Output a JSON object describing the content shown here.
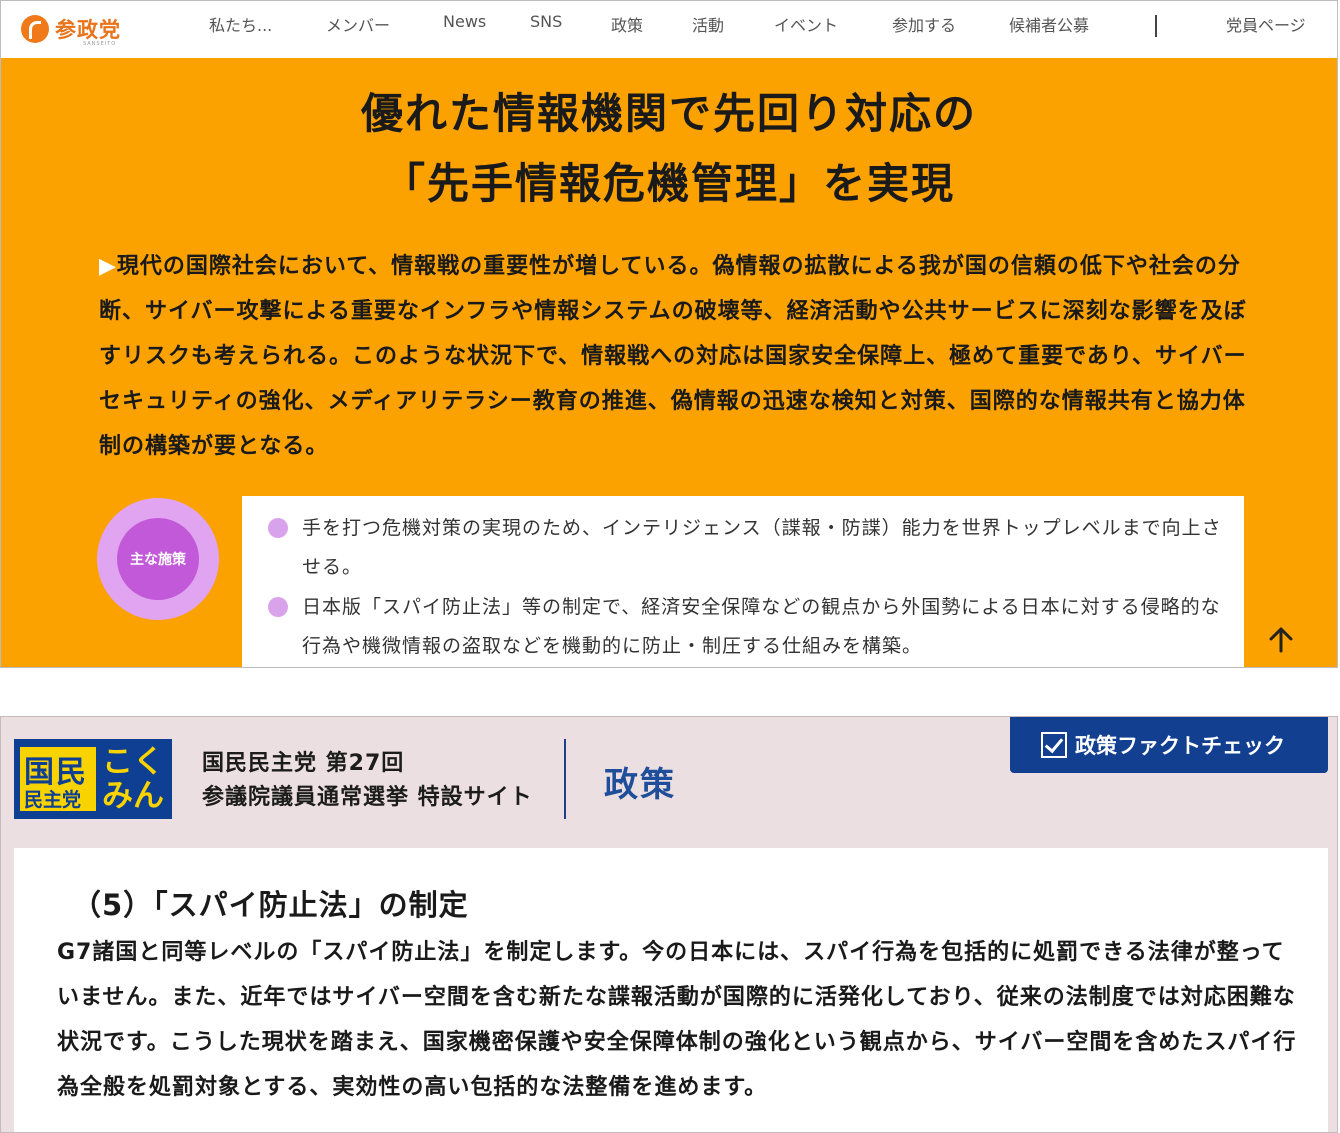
{
  "top": {
    "logo_text": "参政党",
    "logo_sub": "SANSEITO",
    "nav": [
      "私たち...",
      "メンバー",
      "News",
      "SNS",
      "政策",
      "活動",
      "イベント",
      "参加する",
      "候補者公募",
      "党員ページ"
    ],
    "title_line1": "優れた情報機関で先回り対応の",
    "title_line2": "「先手情報危機管理」を実現",
    "intro_marker": "▶",
    "intro": "現代の国際社会において、情報戦の重要性が増している。偽情報の拡散による我が国の信頼の低下や社会の分断、サイバー攻撃による重要なインフラや情報システムの破壊等、経済活動や公共サービスに深刻な影響を及ぼすリスクも考えられる。このような状況下で、情報戦への対応は国家安全保障上、極めて重要であり、サイバーセキュリティの強化、メディアリテラシー教育の推進、偽情報の迅速な検知と対策、国際的な情報共有と協力体制の構築が要となる。",
    "badge": "主な施策",
    "measures": [
      "手を打つ危機対策の実現のため、インテリジェンス（諜報・防諜）能力を世界トップレベルまで向上させる。",
      "日本版「スパイ防止法」等の制定で、経済安全保障などの観点から外国勢による日本に対する侵略的な行為や機微情報の盗取などを機動的に防止・制圧する仕組みを構築。"
    ],
    "icons": {
      "logo": "sanseito-logo-icon",
      "up": "arrow-up-icon",
      "bullet": "circle-bullet-icon"
    },
    "colors": {
      "hero": "#fba100",
      "accent": "#e8731a",
      "badge": "#c259d8"
    }
  },
  "bottom": {
    "logo_big": "国民",
    "logo_small": "民主党",
    "logo_right": "こくみん",
    "site_line1": "国民民主党 第27回",
    "site_line2": "参議院議員通常選挙 特設サイト",
    "page_title": "政策",
    "factcheck": "政策ファクトチェック",
    "heading": "（5）「スパイ防止法」の制定",
    "body": "G7諸国と同等レベルの「スパイ防止法」を制定します。今の日本には、スパイ行為を包括的に処罰できる法律が整っていません。また、近年ではサイバー空間を含む新たな諜報活動が国際的に活発化しており、従来の法制度では対応困難な状況です。こうした現状を踏まえ、国家機密保護や安全保障体制の強化という観点から、サイバー空間を含めたスパイ行為全般を処罰対象とする、実効性の高い包括的な法整備を進めます。",
    "icons": {
      "factcheck": "checkbox-icon"
    },
    "colors": {
      "brand_blue": "#123f8f",
      "brand_yellow": "#f8d300",
      "background": "#ecdfe1"
    }
  }
}
